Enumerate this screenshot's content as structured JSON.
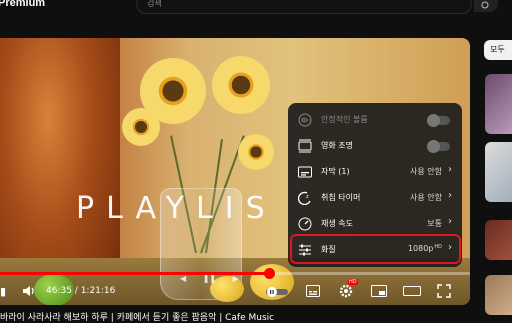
{
  "header": {
    "logo_text": "Premium",
    "search_placeholder": "검색"
  },
  "video": {
    "overlay_text": "PLAYLIS",
    "current_time": "46:35",
    "duration": "1:21:16",
    "progress_fraction": 0.573,
    "time_display": "46:35 / 1:21:16"
  },
  "settings_menu": {
    "items": [
      {
        "label": "안정적인 볼륨",
        "value": "",
        "icon": "volume-wave-icon",
        "toggle": true,
        "disabled": true
      },
      {
        "label": "영화 조명",
        "value": "",
        "icon": "ambient-tv-icon",
        "toggle": true,
        "disabled": false
      },
      {
        "label": "자막 (1)",
        "value": "사용 안함",
        "icon": "subtitles-icon",
        "toggle": false
      },
      {
        "label": "취침 타이머",
        "value": "사용 안함",
        "icon": "sleep-timer-icon",
        "toggle": false
      },
      {
        "label": "재생 속도",
        "value": "보통",
        "icon": "playback-speed-icon",
        "toggle": false
      },
      {
        "label": "화질",
        "value": "1080p",
        "badge": "HD",
        "icon": "quality-sliders-icon",
        "toggle": false
      }
    ]
  },
  "settings_badge": "HD",
  "sidebar": {
    "tab_label": "모두"
  },
  "below_title": "바라이 사라사라 해보하 하루 | 카페에서 듣기 좋은 팝음악 | Cafe Music"
}
